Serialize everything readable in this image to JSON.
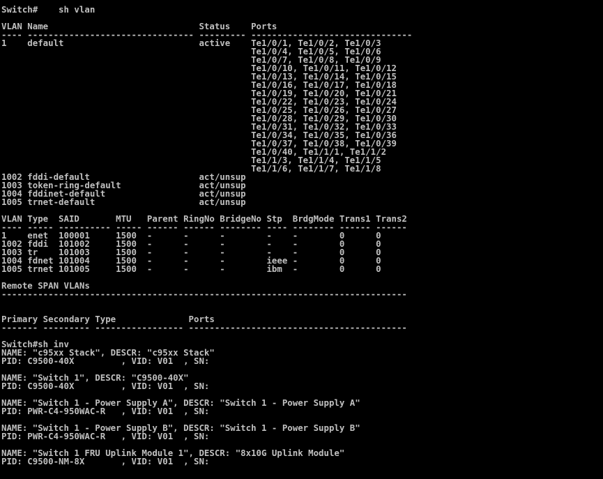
{
  "terminal": {
    "background": "#000000",
    "foreground": "#c0c0c0",
    "lines": [
      "Switch#    sh vlan",
      "",
      "VLAN Name                             Status    Ports",
      "---- -------------------------------- --------- -------------------------------",
      "1    default                          active    Te1/0/1, Te1/0/2, Te1/0/3",
      "                                                Te1/0/4, Te1/0/5, Te1/0/6",
      "                                                Te1/0/7, Te1/0/8, Te1/0/9",
      "                                                Te1/0/10, Te1/0/11, Te1/0/12",
      "                                                Te1/0/13, Te1/0/14, Te1/0/15",
      "                                                Te1/0/16, Te1/0/17, Te1/0/18",
      "                                                Te1/0/19, Te1/0/20, Te1/0/21",
      "                                                Te1/0/22, Te1/0/23, Te1/0/24",
      "                                                Te1/0/25, Te1/0/26, Te1/0/27",
      "                                                Te1/0/28, Te1/0/29, Te1/0/30",
      "                                                Te1/0/31, Te1/0/32, Te1/0/33",
      "                                                Te1/0/34, Te1/0/35, Te1/0/36",
      "                                                Te1/0/37, Te1/0/38, Te1/0/39",
      "                                                Te1/0/40, Te1/1/1, Te1/1/2",
      "                                                Te1/1/3, Te1/1/4, Te1/1/5",
      "                                                Te1/1/6, Te1/1/7, Te1/1/8",
      "1002 fddi-default                     act/unsup",
      "1003 token-ring-default               act/unsup",
      "1004 fddinet-default                  act/unsup",
      "1005 trnet-default                    act/unsup",
      "",
      "VLAN Type  SAID       MTU   Parent RingNo BridgeNo Stp  BrdgMode Trans1 Trans2",
      "---- ----- ---------- ----- ------ ------ -------- ---- -------- ------ ------",
      "1    enet  100001     1500  -      -      -        -    -        0      0",
      "1002 fddi  101002     1500  -      -      -        -    -        0      0",
      "1003 tr    101003     1500  -      -      -        -    -        0      0",
      "1004 fdnet 101004     1500  -      -      -        ieee -        0      0",
      "1005 trnet 101005     1500  -      -      -        ibm  -        0      0",
      "",
      "Remote SPAN VLANs",
      "------------------------------------------------------------------------------",
      "",
      "",
      "Primary Secondary Type              Ports",
      "------- --------- ----------------- ------------------------------------------",
      "",
      "Switch#sh inv",
      "NAME: \"c95xx Stack\", DESCR: \"c95xx Stack\"",
      "PID: C9500-40X         , VID: V01  , SN:",
      "",
      "NAME: \"Switch 1\", DESCR: \"C9500-40X\"",
      "PID: C9500-40X         , VID: V01  , SN:",
      "",
      "NAME: \"Switch 1 - Power Supply A\", DESCR: \"Switch 1 - Power Supply A\"",
      "PID: PWR-C4-950WAC-R   , VID: V01  , SN:",
      "",
      "NAME: \"Switch 1 - Power Supply B\", DESCR: \"Switch 1 - Power Supply B\"",
      "PID: PWR-C4-950WAC-R   , VID: V01  , SN:",
      "",
      "NAME: \"Switch 1 FRU Uplink Module 1\", DESCR: \"8x10G Uplink Module\"",
      "PID: C9500-NM-8X       , VID: V01  , SN:"
    ]
  }
}
